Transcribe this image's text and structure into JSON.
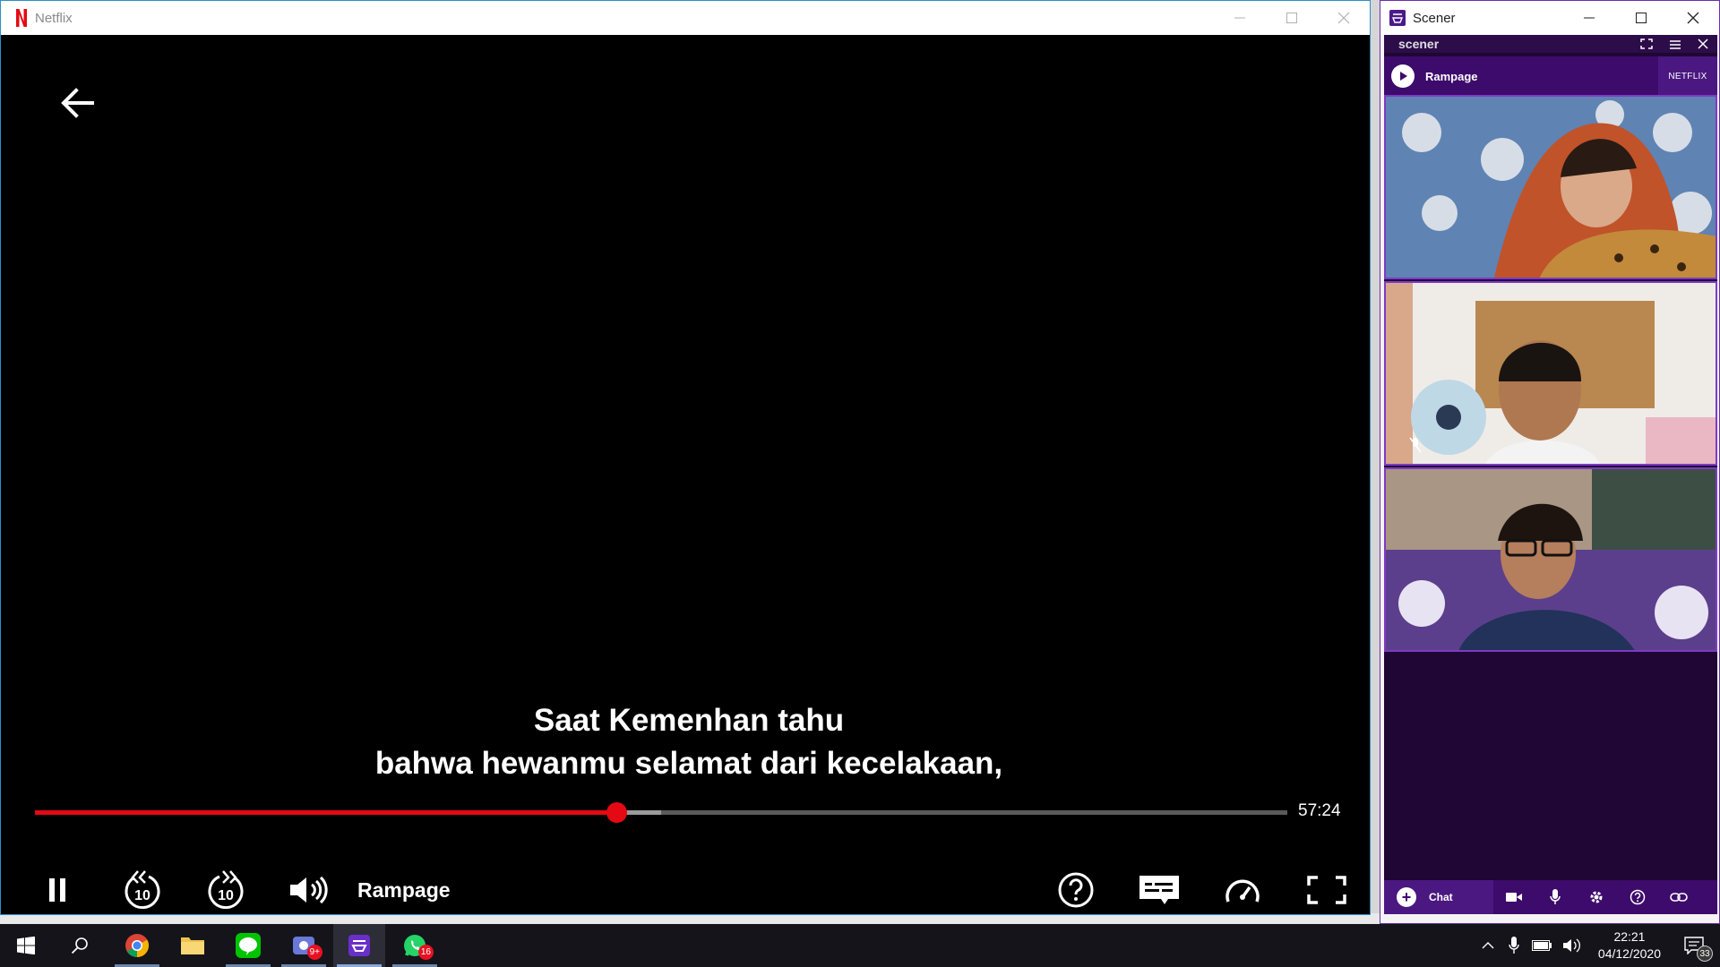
{
  "netflix": {
    "window_title": "Netflix",
    "subtitle_line1": "Saat Kemenhan tahu",
    "subtitle_line2": "bahwa hewanmu selamat dari kecelakaan,",
    "time_remaining": "57:24",
    "movie_title": "Rampage",
    "playback_progress": 0.464,
    "buffered_progress": 0.5,
    "skip_back_seconds": "10",
    "skip_forward_seconds": "10",
    "accent_color": "#e50914"
  },
  "scener": {
    "window_title": "Scener",
    "brand": "scener",
    "now_playing": "Rampage",
    "service": "NETFLIX",
    "chat_label": "Chat",
    "accent_color": "#3d0b6b"
  },
  "taskbar": {
    "clock_time": "22:21",
    "clock_date": "04/12/2020",
    "video_call_badge": "9+",
    "whatsapp_badge": "16",
    "notification_count": "33"
  }
}
